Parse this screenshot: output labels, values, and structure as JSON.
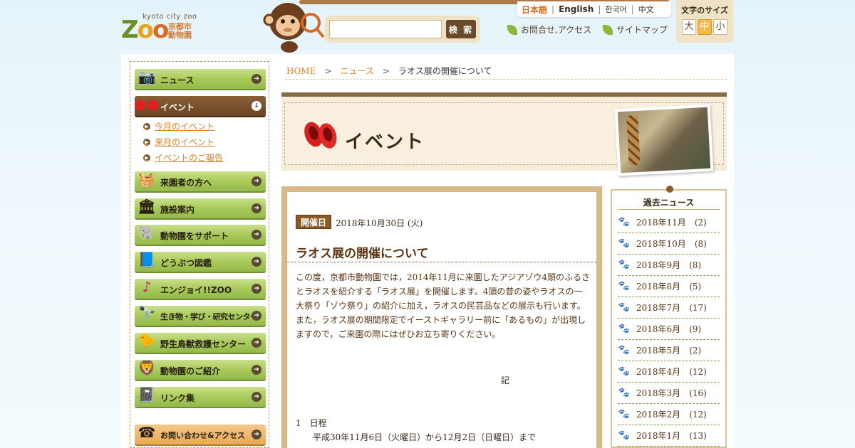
{
  "header": {
    "logo": {
      "word": "Zoo",
      "kyoto_city": "kyoto city zoo",
      "jp_name": "京都市動物園"
    },
    "search": {
      "placeholder": "",
      "button_label": "検 索"
    },
    "languages": [
      {
        "label": "日本語",
        "active": true
      },
      {
        "label": "English",
        "active": false
      },
      {
        "label": "한국어",
        "active": false
      },
      {
        "label": "中文",
        "active": false
      }
    ],
    "links": {
      "access": "お問合せ,アクセス",
      "sitemap": "サイトマップ"
    },
    "text_size": {
      "label": "文字のサイズ",
      "large": "大",
      "medium": "中",
      "small": "小",
      "selected": "中"
    }
  },
  "sidebar": {
    "items": [
      {
        "label": "ニュース",
        "icon": "camera-icon"
      },
      {
        "label": "イベント",
        "icon": "red-shoes-icon",
        "active": true
      },
      {
        "label": "来園者の方へ",
        "icon": "basket-icon"
      },
      {
        "label": "施設案内",
        "icon": "building-icon"
      },
      {
        "label": "動物園をサポート",
        "icon": "elephant-icon"
      },
      {
        "label": "どうぶつ図鑑",
        "icon": "book-icon"
      },
      {
        "label": "エンジョイ!!ZOO",
        "icon": "music-note-icon"
      },
      {
        "label": "生き物・学び・研究センター",
        "icon": "binoculars-icon"
      },
      {
        "label": "野生鳥獣救護センター",
        "icon": "bird-icon"
      },
      {
        "label": "動物園のご紹介",
        "icon": "lion-icon"
      },
      {
        "label": "リンク集",
        "icon": "notebook-icon"
      }
    ],
    "sub_items": [
      "今月のイベント",
      "来月のイベント",
      "イベントのご報告"
    ],
    "contact": {
      "label": "お問い合わせ&アクセス",
      "icon": "telephone-icon"
    }
  },
  "breadcrumb": {
    "home": "HOME",
    "news": "ニュース",
    "current": "ラオス展の開催について",
    "separator": ">"
  },
  "banner": {
    "title": "イベント"
  },
  "article": {
    "badge": "開催日",
    "date": "2018年10月30日 (火)",
    "title": "ラオス展の開催について",
    "body": "この度，京都市動物園では，2014年11月に来園したアジアゾウ4頭のふるさとラオスを紹介する「ラオス展」を開催します。4頭の昔の姿やラオスの一大祭り「ゾウ祭り」の紹介に加え，ラオスの民芸品などの展示も行います。また，ラオス展の期間限定でイーストギャラリー前に「あるもの」が出現しますので，ご来園の際にはぜひお立ち寄りください。",
    "ki": "記",
    "schedule_heading": "1　日程",
    "schedule_detail": "平成30年11月6日（火曜日）から12月2日（日曜日）まで"
  },
  "past_news": {
    "title": "過去ニュース",
    "items": [
      {
        "month": "2018年11月",
        "count": "(2)"
      },
      {
        "month": "2018年10月",
        "count": "(8)"
      },
      {
        "month": "2018年9月",
        "count": "(8)"
      },
      {
        "month": "2018年8月",
        "count": "(5)"
      },
      {
        "month": "2018年7月",
        "count": "(17)"
      },
      {
        "month": "2018年6月",
        "count": "(9)"
      },
      {
        "month": "2018年5月",
        "count": "(2)"
      },
      {
        "month": "2018年4月",
        "count": "(12)"
      },
      {
        "month": "2018年3月",
        "count": "(16)"
      },
      {
        "month": "2018年2月",
        "count": "(12)"
      },
      {
        "month": "2018年1月",
        "count": "(13)"
      }
    ]
  },
  "colors": {
    "link": "#d9832a",
    "nav_green": "#a9ca5a",
    "nav_active": "#6b4424",
    "article_title": "#5a3414"
  }
}
